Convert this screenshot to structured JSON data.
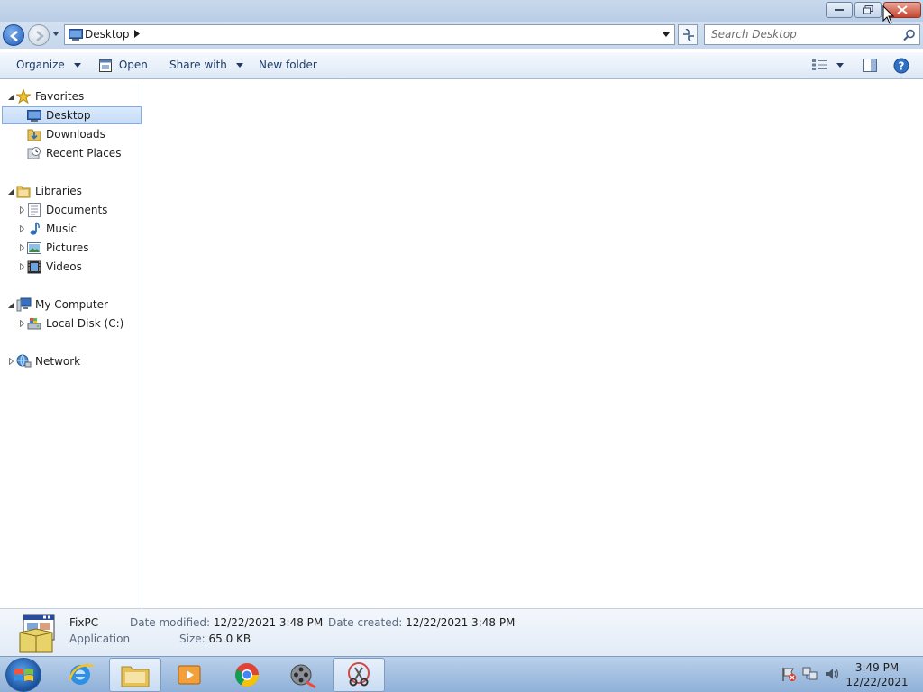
{
  "window": {
    "minimize_icon": "minimize-icon",
    "restore_icon": "restore-icon",
    "close_icon": "close-icon"
  },
  "address": {
    "crumb": "Desktop",
    "search_placeholder": "Search Desktop"
  },
  "toolbar": {
    "organize": "Organize",
    "open": "Open",
    "share_with": "Share with",
    "new_folder": "New folder"
  },
  "nav": {
    "favorites": {
      "label": "Favorites",
      "items": [
        "Desktop",
        "Downloads",
        "Recent Places"
      ]
    },
    "libraries": {
      "label": "Libraries",
      "items": [
        "Documents",
        "Music",
        "Pictures",
        "Videos"
      ]
    },
    "computer": {
      "label": "My Computer",
      "items": [
        "Local Disk (C:)"
      ]
    },
    "network": {
      "label": "Network"
    },
    "selected": "Desktop"
  },
  "details": {
    "name": "FixPC",
    "type": "Application",
    "date_modified_label": "Date modified:",
    "date_modified": "12/22/2021 3:48 PM",
    "date_created_label": "Date created:",
    "date_created": "12/22/2021 3:48 PM",
    "size_label": "Size:",
    "size": "65.0 KB"
  },
  "taskbar": {
    "apps": [
      "start-orb",
      "internet-explorer",
      "file-explorer",
      "media-player",
      "chrome",
      "video-editor",
      "snipping-tool"
    ],
    "time": "3:49 PM",
    "date": "12/22/2021"
  },
  "colors": {
    "accent": "#1f5bb6",
    "selection": "#c5dcf8",
    "close": "#c7452f"
  }
}
